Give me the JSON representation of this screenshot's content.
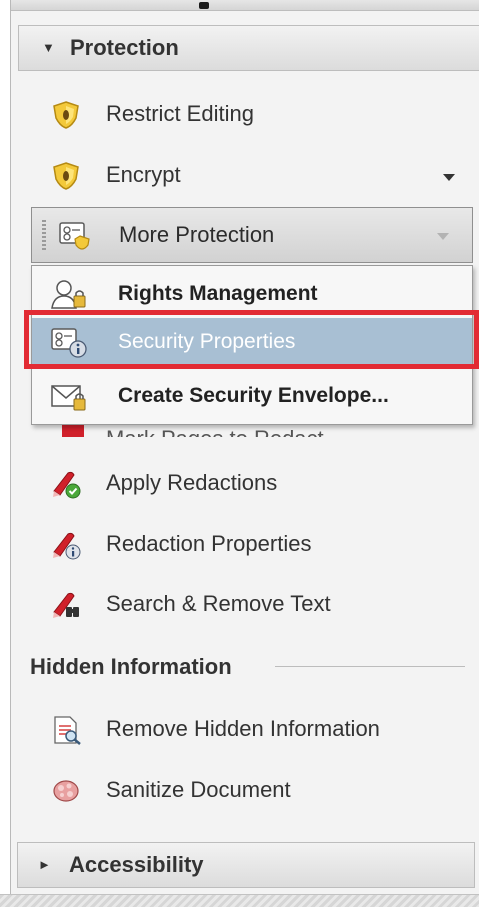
{
  "sections": {
    "protection": {
      "label": "Protection",
      "expanded": true
    },
    "accessibility": {
      "label": "Accessibility",
      "expanded": false
    }
  },
  "protection_items": [
    {
      "label": "Restrict Editing",
      "icon": "shield-icon"
    },
    {
      "label": "Encrypt",
      "icon": "shield-icon"
    }
  ],
  "more_protection": {
    "label": "More Protection",
    "icon": "certificate-lock-icon"
  },
  "menu": {
    "items": [
      {
        "label": "Rights Management",
        "icon": "user-lock-icon"
      },
      {
        "label": "Security Properties",
        "icon": "certificate-info-icon",
        "selected": true
      },
      {
        "label": "Create Security Envelope...",
        "icon": "envelope-lock-icon"
      }
    ]
  },
  "obscured_item": {
    "label": "Mark Pages to Redact"
  },
  "redaction_items": [
    {
      "label": "Apply Redactions",
      "icon": "redaction-check-icon"
    },
    {
      "label": "Redaction Properties",
      "icon": "redaction-info-icon"
    },
    {
      "label": "Search & Remove Text",
      "icon": "redaction-search-icon"
    }
  ],
  "hidden_info": {
    "title": "Hidden Information",
    "items": [
      {
        "label": "Remove Hidden Information",
        "icon": "remove-hidden-info-icon"
      },
      {
        "label": "Sanitize Document",
        "icon": "sanitize-icon"
      }
    ]
  },
  "colors": {
    "highlight_border": "#e22b34",
    "selected_row": "#a8bfd3",
    "shield_yellow": "#f3c93a",
    "redaction_red": "#d0202a"
  }
}
